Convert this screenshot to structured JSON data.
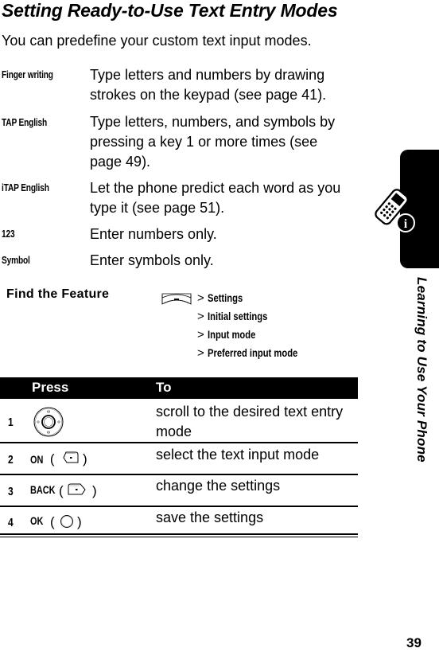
{
  "page": {
    "title": "Setting Ready-to-Use Text Entry Modes",
    "intro": "You can predefine your custom text input modes.",
    "modes": [
      {
        "label": "Finger writing",
        "description": "Type letters and numbers by drawing strokes on the keypad (see page 41)."
      },
      {
        "label": "TAP English",
        "description": "Type letters, numbers, and symbols by pressing a key 1 or more times (see page 49)."
      },
      {
        "label": "iTAP English",
        "description": "Let the phone predict each word as you type it (see page 51)."
      },
      {
        "label": "123",
        "description": "Enter numbers only."
      },
      {
        "label": "Symbol",
        "description": "Enter symbols only."
      }
    ],
    "find_feature": {
      "label": "Find the Feature",
      "icon": "menu-key-icon",
      "separator": ">",
      "path": [
        "Settings",
        "Initial settings",
        "Input mode",
        "Preferred input mode"
      ]
    },
    "table": {
      "headers": {
        "press": "Press",
        "to": "To"
      },
      "rows": [
        {
          "num": "1",
          "key": "",
          "key_icon": "nav-key-icon",
          "description": "scroll to the desired text entry mode"
        },
        {
          "num": "2",
          "key": "ON",
          "key_icon": "left-soft-key-icon",
          "description": "select the text input mode"
        },
        {
          "num": "3",
          "key": "BACK",
          "key_icon": "right-soft-key-icon",
          "description": "change the settings"
        },
        {
          "num": "4",
          "key": "OK",
          "key_icon": "center-select-key-icon",
          "description": "save the settings"
        }
      ],
      "paren_open": "(",
      "paren_close": ")"
    },
    "side_tab": {
      "icon": "phone-info-icon",
      "title": "Learning to Use Your Phone"
    },
    "page_number": "39"
  }
}
